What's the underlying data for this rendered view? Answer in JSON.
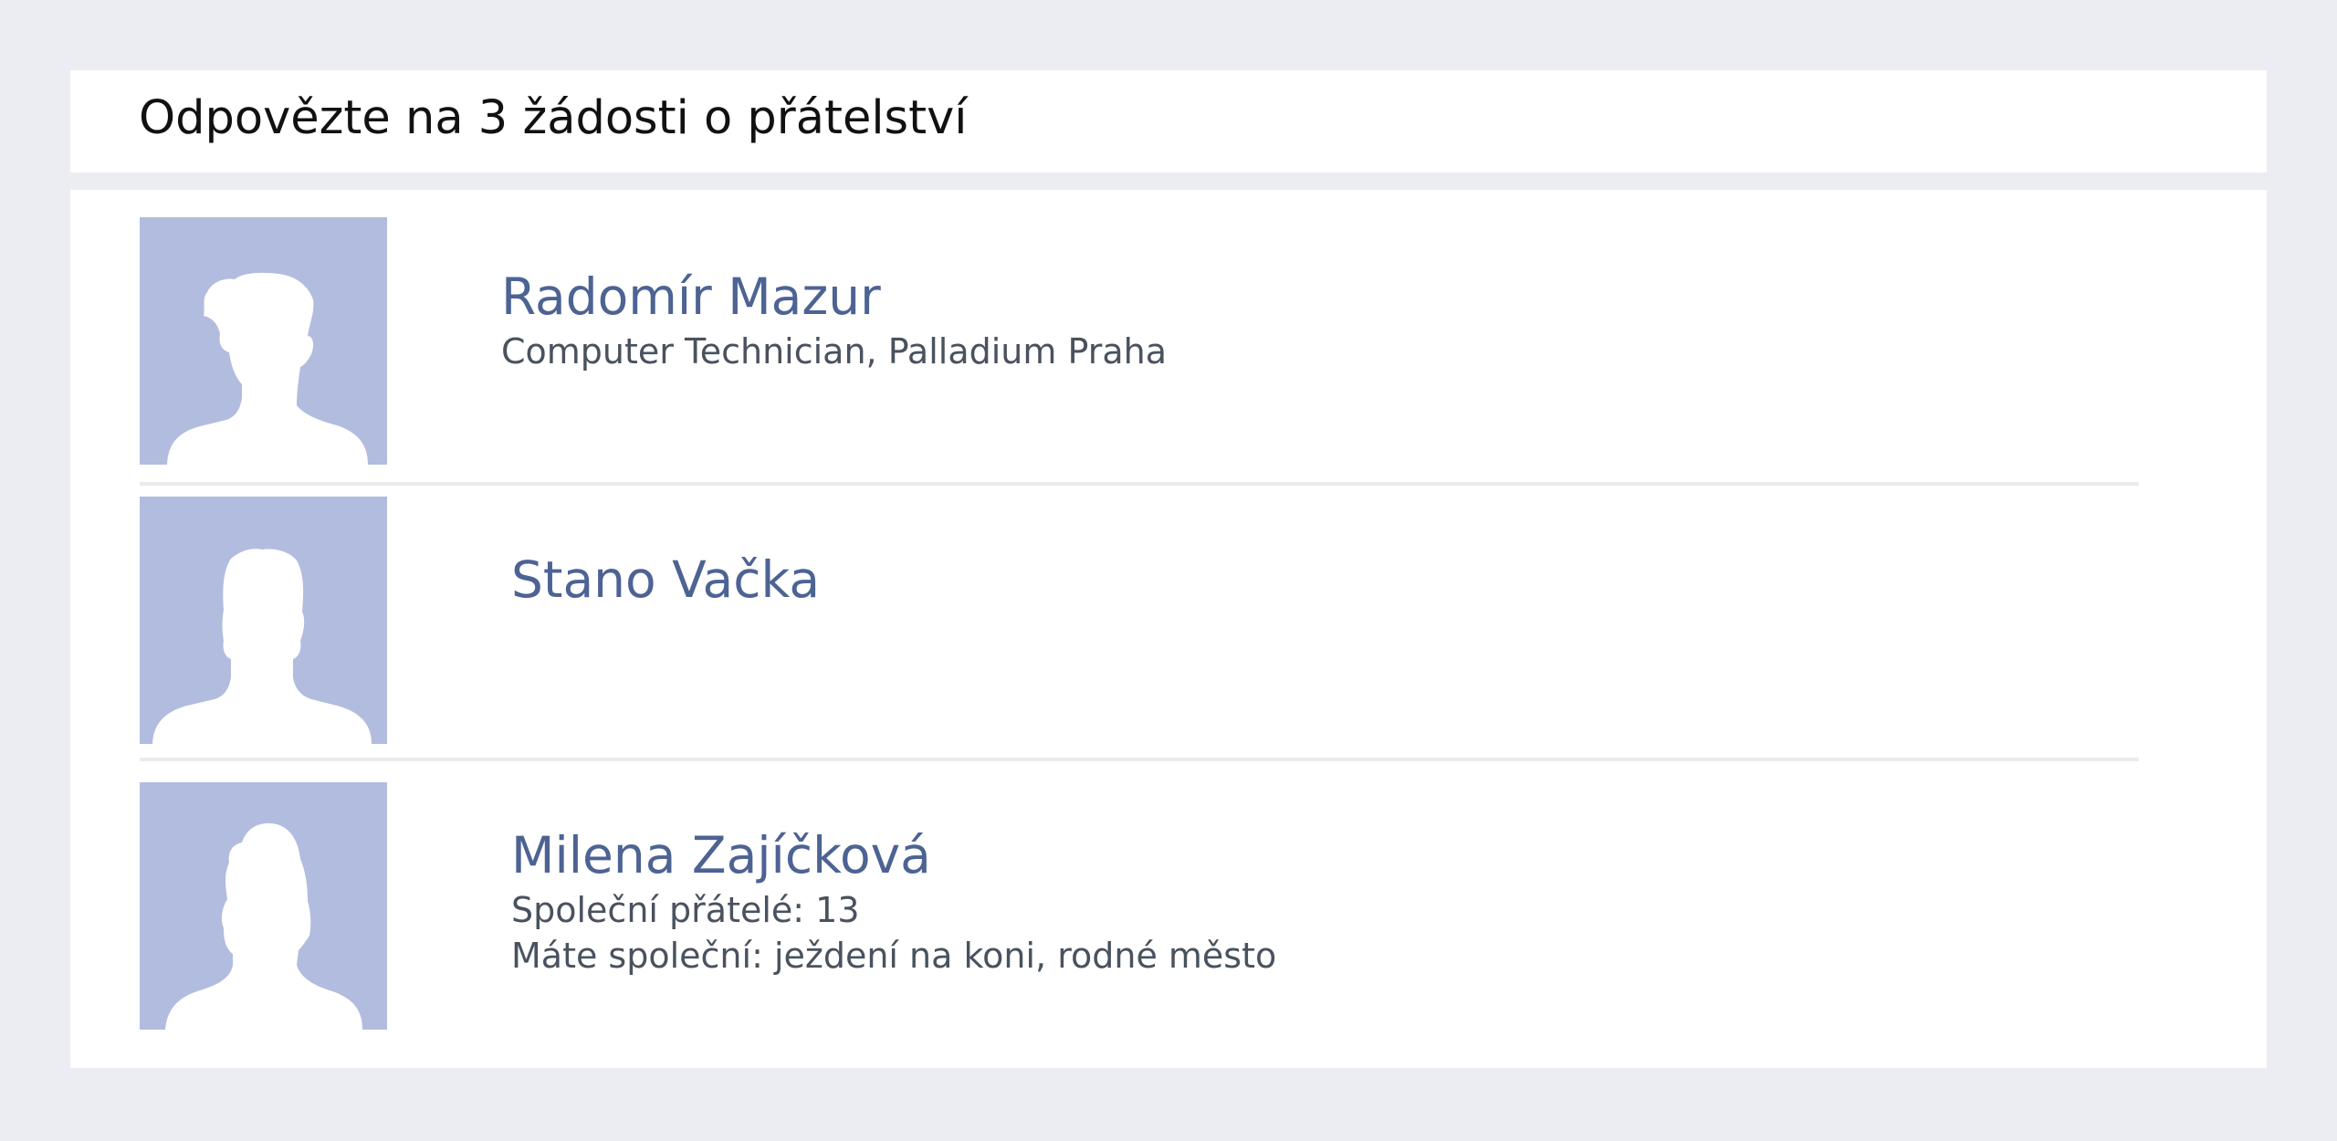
{
  "header": {
    "title": "Odpovězte na 3 žádosti o přátelství"
  },
  "requests": [
    {
      "name": "Radomír Mazur",
      "details": [
        "Computer Technician, Palladium Praha"
      ],
      "avatar": "male-silhouette-icon"
    },
    {
      "name": "Stano Vačka",
      "details": [],
      "avatar": "male-silhouette-icon"
    },
    {
      "name": "Milena Zajíčková",
      "details": [
        "Společní přátelé: 13",
        "Máte společní: ježdení na koni, rodné město"
      ],
      "avatar": "female-silhouette-icon"
    }
  ],
  "colors": {
    "background": "#ebedf2",
    "panel": "#ffffff",
    "avatar_bg": "#b2bcde",
    "name": "#4d6393",
    "detail": "#49525e",
    "divider": "#e9ebef"
  }
}
